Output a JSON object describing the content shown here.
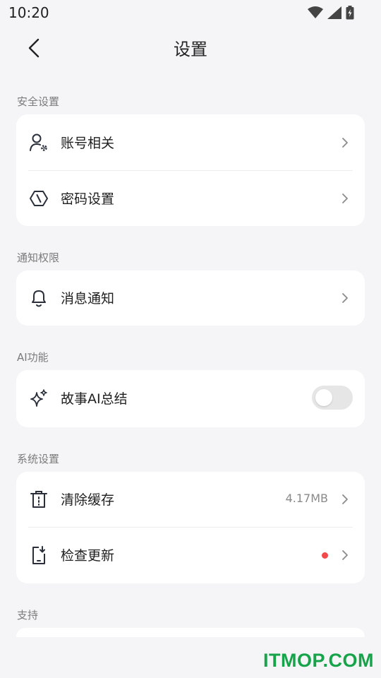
{
  "status_bar": {
    "time": "10:20"
  },
  "header": {
    "title": "设置"
  },
  "sections": [
    {
      "label": "安全设置",
      "items": [
        {
          "label": "账号相关",
          "icon": "account-settings-icon"
        },
        {
          "label": "密码设置",
          "icon": "password-hexagon-icon"
        }
      ]
    },
    {
      "label": "通知权限",
      "items": [
        {
          "label": "消息通知",
          "icon": "bell-icon"
        }
      ]
    },
    {
      "label": "AI功能",
      "items": [
        {
          "label": "故事AI总结",
          "icon": "sparkle-icon",
          "toggle_on": false
        }
      ]
    },
    {
      "label": "系统设置",
      "items": [
        {
          "label": "清除缓存",
          "icon": "trash-icon",
          "value": "4.17MB"
        },
        {
          "label": "检查更新",
          "icon": "phone-download-icon",
          "badge": "red-dot"
        }
      ]
    },
    {
      "label": "支持",
      "items": []
    }
  ],
  "watermark": "ITMOP.COM",
  "colors": {
    "background": "#f5f5f7",
    "card": "#ffffff",
    "badge": "#f24a4a",
    "toggle_off": "#e6e6e6",
    "watermark": "#17a34a"
  }
}
